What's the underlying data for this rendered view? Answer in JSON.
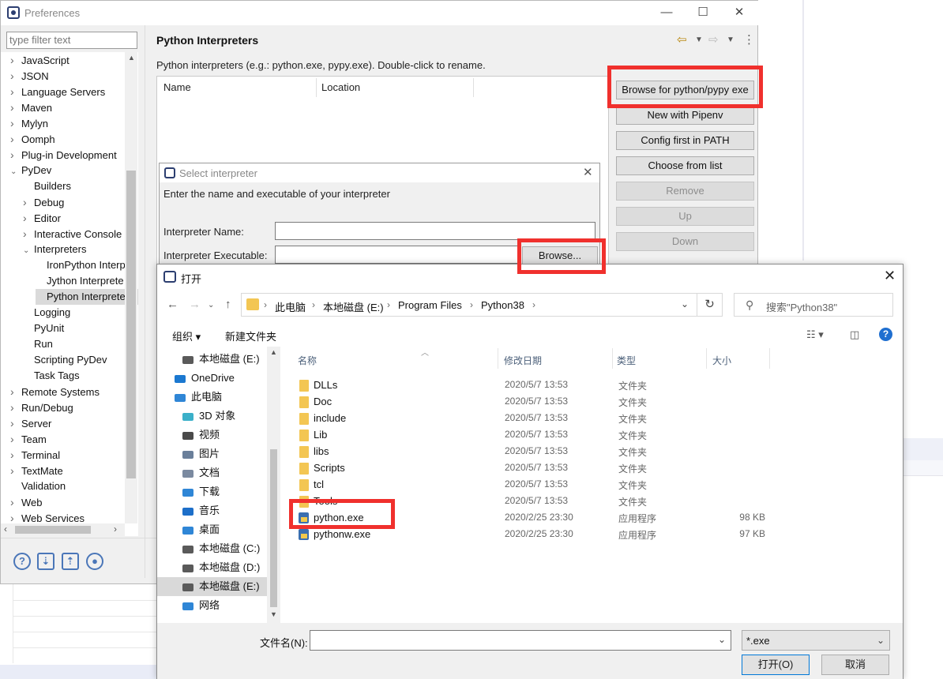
{
  "preferences": {
    "window_title": "Preferences",
    "filter_placeholder": "type filter text",
    "tree": [
      {
        "label": "JavaScript",
        "level": 0,
        "expander": "collapsed"
      },
      {
        "label": "JSON",
        "level": 0,
        "expander": "collapsed"
      },
      {
        "label": "Language Servers",
        "level": 0,
        "expander": "collapsed"
      },
      {
        "label": "Maven",
        "level": 0,
        "expander": "collapsed"
      },
      {
        "label": "Mylyn",
        "level": 0,
        "expander": "collapsed"
      },
      {
        "label": "Oomph",
        "level": 0,
        "expander": "collapsed"
      },
      {
        "label": "Plug-in Development",
        "level": 0,
        "expander": "collapsed"
      },
      {
        "label": "PyDev",
        "level": 0,
        "expander": "expanded"
      },
      {
        "label": "Builders",
        "level": 1,
        "expander": "none"
      },
      {
        "label": "Debug",
        "level": 1,
        "expander": "collapsed"
      },
      {
        "label": "Editor",
        "level": 1,
        "expander": "collapsed"
      },
      {
        "label": "Interactive Console",
        "level": 1,
        "expander": "collapsed"
      },
      {
        "label": "Interpreters",
        "level": 1,
        "expander": "expanded"
      },
      {
        "label": "IronPython Interp",
        "level": 2,
        "expander": "none"
      },
      {
        "label": "Jython Interprete",
        "level": 2,
        "expander": "none"
      },
      {
        "label": "Python Interprete",
        "level": 2,
        "expander": "none",
        "selected": true
      },
      {
        "label": "Logging",
        "level": 1,
        "expander": "none"
      },
      {
        "label": "PyUnit",
        "level": 1,
        "expander": "none"
      },
      {
        "label": "Run",
        "level": 1,
        "expander": "none"
      },
      {
        "label": "Scripting PyDev",
        "level": 1,
        "expander": "none"
      },
      {
        "label": "Task Tags",
        "level": 1,
        "expander": "none"
      },
      {
        "label": "Remote Systems",
        "level": 0,
        "expander": "collapsed"
      },
      {
        "label": "Run/Debug",
        "level": 0,
        "expander": "collapsed"
      },
      {
        "label": "Server",
        "level": 0,
        "expander": "collapsed"
      },
      {
        "label": "Team",
        "level": 0,
        "expander": "collapsed"
      },
      {
        "label": "Terminal",
        "level": 0,
        "expander": "collapsed"
      },
      {
        "label": "TextMate",
        "level": 0,
        "expander": "collapsed"
      },
      {
        "label": "Validation",
        "level": 0,
        "expander": "none"
      },
      {
        "label": "Web",
        "level": 0,
        "expander": "collapsed"
      },
      {
        "label": "Web Services",
        "level": 0,
        "expander": "collapsed"
      }
    ],
    "page_title": "Python Interpreters",
    "description": "Python interpreters (e.g.: python.exe, pypy.exe).   Double-click to rename.",
    "table_headers": [
      "Name",
      "Location"
    ],
    "buttons": {
      "browse": "Browse for python/pypy exe",
      "pipenv": "New with Pipenv",
      "config_path": "Config first in PATH",
      "choose_list": "Choose from list",
      "remove": "Remove",
      "up": "Up",
      "down": "Down"
    },
    "bottom_icons": [
      "help-icon",
      "import-icon",
      "export-icon",
      "record-icon"
    ]
  },
  "select_interpreter": {
    "title": "Select interpreter",
    "message": "Enter the name and executable of your interpreter",
    "name_label": "Interpreter Name:",
    "exe_label": "Interpreter Executable:",
    "browse_label": "Browse..."
  },
  "open_dialog": {
    "title": "打开",
    "breadcrumb": [
      "此电脑",
      "本地磁盘 (E:)",
      "Program Files",
      "Python38"
    ],
    "search_placeholder": "搜索\"Python38\"",
    "organize": "组织 ▾",
    "new_folder": "新建文件夹",
    "nav_items": [
      {
        "label": "本地磁盘 (E:)",
        "icon": "drive-icon",
        "indent": 1
      },
      {
        "label": "OneDrive",
        "icon": "cloud-icon",
        "indent": 0
      },
      {
        "label": "此电脑",
        "icon": "computer-icon",
        "indent": 0
      },
      {
        "label": "3D 对象",
        "icon": "cube-icon",
        "indent": 1
      },
      {
        "label": "视频",
        "icon": "video-icon",
        "indent": 1
      },
      {
        "label": "图片",
        "icon": "picture-icon",
        "indent": 1
      },
      {
        "label": "文档",
        "icon": "document-icon",
        "indent": 1
      },
      {
        "label": "下载",
        "icon": "download-icon",
        "indent": 1
      },
      {
        "label": "音乐",
        "icon": "music-icon",
        "indent": 1
      },
      {
        "label": "桌面",
        "icon": "desktop-icon",
        "indent": 1
      },
      {
        "label": "本地磁盘 (C:)",
        "icon": "drive-icon",
        "indent": 1
      },
      {
        "label": "本地磁盘 (D:)",
        "icon": "drive-icon",
        "indent": 1
      },
      {
        "label": "本地磁盘 (E:)",
        "icon": "drive-icon",
        "indent": 1,
        "selected": true
      },
      {
        "label": "网络",
        "icon": "network-icon",
        "indent": 1
      }
    ],
    "columns": [
      "名称",
      "修改日期",
      "类型",
      "大小"
    ],
    "files": [
      {
        "name": "DLLs",
        "date": "2020/5/7 13:53",
        "type": "文件夹",
        "size": "",
        "kind": "folder"
      },
      {
        "name": "Doc",
        "date": "2020/5/7 13:53",
        "type": "文件夹",
        "size": "",
        "kind": "folder"
      },
      {
        "name": "include",
        "date": "2020/5/7 13:53",
        "type": "文件夹",
        "size": "",
        "kind": "folder"
      },
      {
        "name": "Lib",
        "date": "2020/5/7 13:53",
        "type": "文件夹",
        "size": "",
        "kind": "folder"
      },
      {
        "name": "libs",
        "date": "2020/5/7 13:53",
        "type": "文件夹",
        "size": "",
        "kind": "folder"
      },
      {
        "name": "Scripts",
        "date": "2020/5/7 13:53",
        "type": "文件夹",
        "size": "",
        "kind": "folder"
      },
      {
        "name": "tcl",
        "date": "2020/5/7 13:53",
        "type": "文件夹",
        "size": "",
        "kind": "folder"
      },
      {
        "name": "Tools",
        "date": "2020/5/7 13:53",
        "type": "文件夹",
        "size": "",
        "kind": "folder"
      },
      {
        "name": "python.exe",
        "date": "2020/2/25 23:30",
        "type": "应用程序",
        "size": "98 KB",
        "kind": "exe"
      },
      {
        "name": "pythonw.exe",
        "date": "2020/2/25 23:30",
        "type": "应用程序",
        "size": "97 KB",
        "kind": "exe"
      }
    ],
    "filename_label": "文件名(N):",
    "filename_value": "",
    "filetype": "*.exe",
    "open_label": "打开(O)",
    "cancel_label": "取消"
  },
  "colors": {
    "highlight": "#f0302d",
    "selection": "#dadada",
    "accent": "#0078d7"
  }
}
